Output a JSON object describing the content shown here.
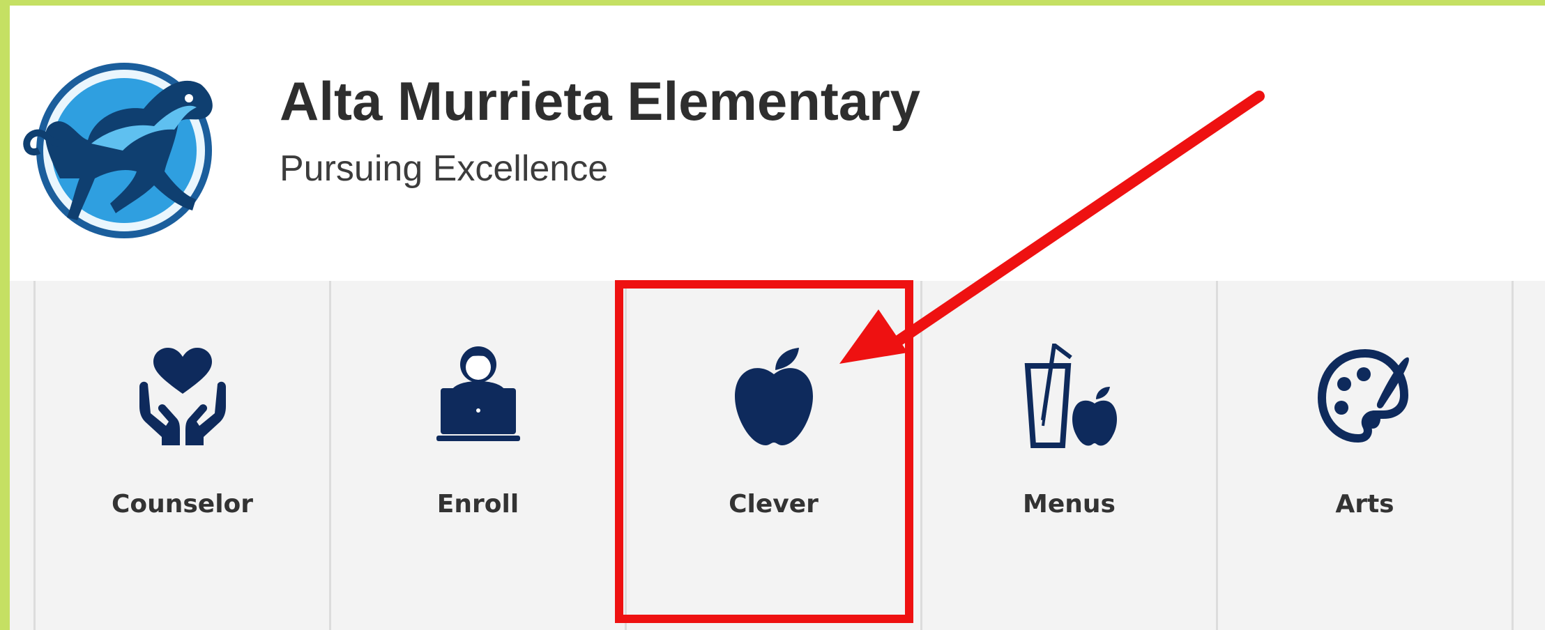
{
  "school": {
    "name": "Alta Murrieta Elementary",
    "tagline": "Pursuing Excellence"
  },
  "quick_links": [
    {
      "label": "Counselor",
      "icon": "heart-hands-icon"
    },
    {
      "label": "Enroll",
      "icon": "person-laptop-icon"
    },
    {
      "label": "Clever",
      "icon": "apple-icon"
    },
    {
      "label": "Menus",
      "icon": "drink-apple-icon"
    },
    {
      "label": "Arts",
      "icon": "palette-brush-icon"
    }
  ],
  "colors": {
    "icon": "#0e2a5c",
    "annotation": "#ee1111",
    "page_border": "#c5e063",
    "logo_blue": "#2f9fe0"
  }
}
